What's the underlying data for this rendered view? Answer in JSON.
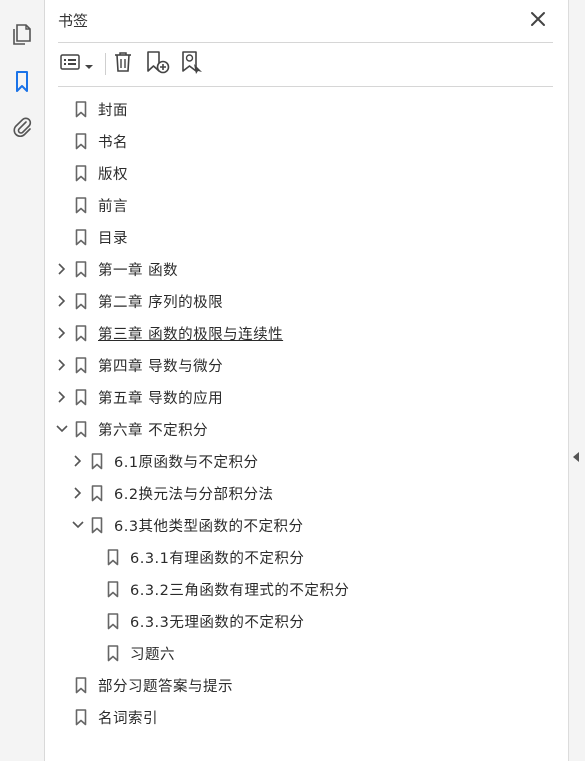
{
  "panel": {
    "title": "书签"
  },
  "toolbar": {
    "options_icon": "list-options-icon",
    "delete_icon": "trash-icon",
    "new_icon": "new-bookmark-icon",
    "find_icon": "find-bookmark-icon"
  },
  "tree": [
    {
      "label": "封面",
      "level": 0,
      "state": "none"
    },
    {
      "label": "书名",
      "level": 0,
      "state": "none"
    },
    {
      "label": "版权",
      "level": 0,
      "state": "none"
    },
    {
      "label": "前言",
      "level": 0,
      "state": "none"
    },
    {
      "label": "目录",
      "level": 0,
      "state": "none"
    },
    {
      "label": "第一章  函数",
      "level": 0,
      "state": "collapsed"
    },
    {
      "label": "第二章  序列的极限",
      "level": 0,
      "state": "collapsed"
    },
    {
      "label": "第三章  函数的极限与连续性",
      "level": 0,
      "state": "collapsed",
      "hover": true
    },
    {
      "label": "第四章  导数与微分",
      "level": 0,
      "state": "collapsed"
    },
    {
      "label": "第五章  导数的应用",
      "level": 0,
      "state": "collapsed"
    },
    {
      "label": "第六章  不定积分",
      "level": 0,
      "state": "expanded"
    },
    {
      "label": "6.1原函数与不定积分",
      "level": 1,
      "state": "collapsed"
    },
    {
      "label": "6.2换元法与分部积分法",
      "level": 1,
      "state": "collapsed"
    },
    {
      "label": "6.3其他类型函数的不定积分",
      "level": 1,
      "state": "expanded"
    },
    {
      "label": "6.3.1有理函数的不定积分",
      "level": 2,
      "state": "none"
    },
    {
      "label": "6.3.2三角函数有理式的不定积分",
      "level": 2,
      "state": "none"
    },
    {
      "label": "6.3.3无理函数的不定积分",
      "level": 2,
      "state": "none"
    },
    {
      "label": "习题六",
      "level": 2,
      "state": "none"
    },
    {
      "label": "部分习题答案与提示",
      "level": 0,
      "state": "none"
    },
    {
      "label": "名词索引",
      "level": 0,
      "state": "none"
    }
  ]
}
